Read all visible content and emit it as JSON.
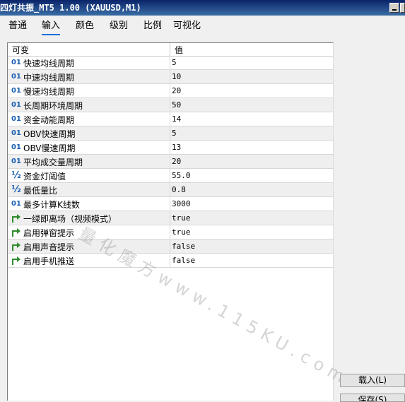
{
  "window": {
    "title": "四灯共振_MT5 1.00 (XAUUSD,M1)"
  },
  "tabs": [
    {
      "label": "普通",
      "active": false
    },
    {
      "label": "输入",
      "active": true
    },
    {
      "label": "颜色",
      "active": false
    },
    {
      "label": "级别",
      "active": false
    },
    {
      "label": "比例",
      "active": false
    },
    {
      "label": "可视化",
      "active": false
    }
  ],
  "table": {
    "headers": {
      "name": "可变",
      "value": "值"
    },
    "rows": [
      {
        "icon": "int-icon",
        "icon_text": "01",
        "name": "快速均线周期",
        "value": "5"
      },
      {
        "icon": "int-icon",
        "icon_text": "01",
        "name": "中速均线周期",
        "value": "10"
      },
      {
        "icon": "int-icon",
        "icon_text": "01",
        "name": "慢速均线周期",
        "value": "20"
      },
      {
        "icon": "int-icon",
        "icon_text": "01",
        "name": "长周期环境周期",
        "value": "50"
      },
      {
        "icon": "int-icon",
        "icon_text": "01",
        "name": "资金动能周期",
        "value": "14"
      },
      {
        "icon": "int-icon",
        "icon_text": "01",
        "name": "OBV快速周期",
        "value": "5"
      },
      {
        "icon": "int-icon",
        "icon_text": "01",
        "name": "OBV慢速周期",
        "value": "13"
      },
      {
        "icon": "int-icon",
        "icon_text": "01",
        "name": "平均成交量周期",
        "value": "20"
      },
      {
        "icon": "double-icon",
        "icon_text": "½",
        "name": "资金灯阈值",
        "value": "55.0"
      },
      {
        "icon": "double-icon",
        "icon_text": "½",
        "name": "最低量比",
        "value": "0.8"
      },
      {
        "icon": "int-icon",
        "icon_text": "01",
        "name": "最多计算K线数",
        "value": "3000"
      },
      {
        "icon": "bool-icon",
        "icon_text": "",
        "name": "一绿即离场（视频模式）",
        "value": "true"
      },
      {
        "icon": "bool-icon",
        "icon_text": "",
        "name": "启用弹窗提示",
        "value": "true"
      },
      {
        "icon": "bool-icon",
        "icon_text": "",
        "name": "启用声音提示",
        "value": "false"
      },
      {
        "icon": "bool-icon",
        "icon_text": "",
        "name": "启用手机推送",
        "value": "false"
      }
    ]
  },
  "watermark": "量化魔方www.115KU.com",
  "buttons": {
    "load": "载入(L)",
    "save": "保存(S)"
  },
  "colors": {
    "accent": "#1e6fd9",
    "icon_blue": "#1a5fb4",
    "bool_green": "#2e8b2e"
  }
}
